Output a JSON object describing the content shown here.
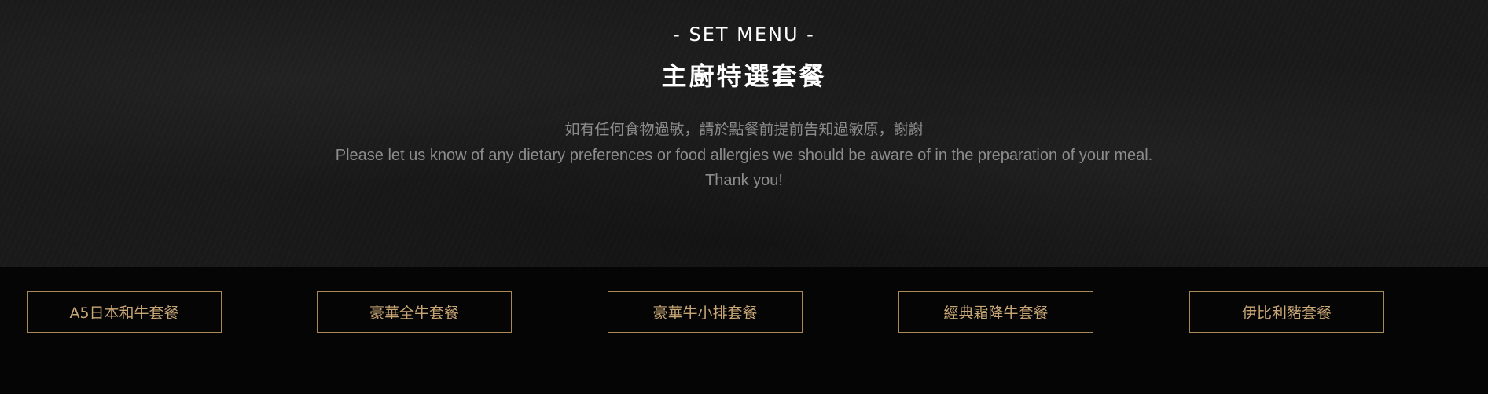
{
  "header": {
    "eyebrow": "- SET MENU -",
    "title": "主廚特選套餐"
  },
  "notice": {
    "zh": "如有任何食物過敏，請於點餐前提前告知過敏原，謝謝",
    "en": "Please let us know of any dietary preferences or food allergies we should be aware of in the preparation of your meal.",
    "thanks": "Thank you!"
  },
  "tabs": [
    {
      "label": "A5日本和牛套餐"
    },
    {
      "label": "豪華全牛套餐"
    },
    {
      "label": "豪華牛小排套餐"
    },
    {
      "label": "經典霜降牛套餐"
    },
    {
      "label": "伊比利豬套餐"
    }
  ],
  "colors": {
    "hero_background": "#1a1a1a",
    "page_background": "#050505",
    "tab_border": "#a88a57",
    "tab_text": "#c8a675",
    "notice_text": "#8c8c8c"
  }
}
